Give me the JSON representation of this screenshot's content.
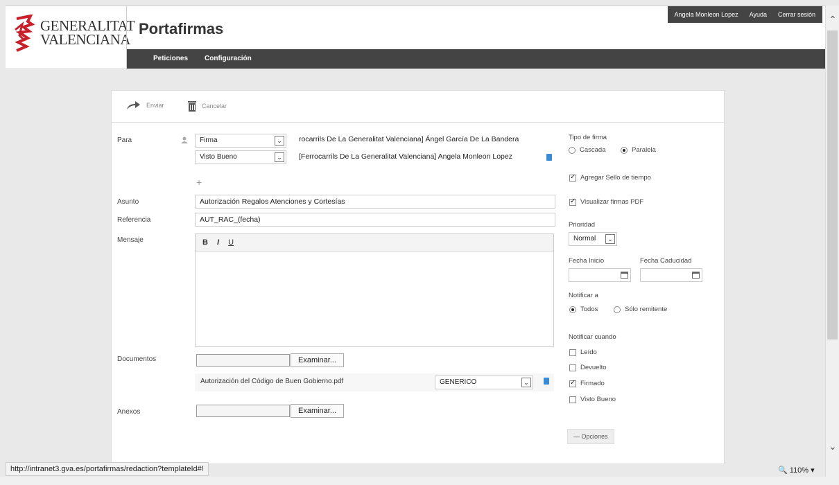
{
  "header": {
    "logo_line1": "GENERALITAT",
    "logo_line2": "VALENCIANA",
    "app_title": "Portafirmas",
    "nav": [
      "Peticiones",
      "Configuración"
    ],
    "user_name": "Angela Monleon Lopez",
    "help": "Ayuda",
    "logout": "Cerrar sesión"
  },
  "toolbar": {
    "send": "Enviar",
    "cancel": "Cancelar"
  },
  "form": {
    "para_label": "Para",
    "recipients": [
      {
        "type": "Firma",
        "name": "rocarrils De La Generalitat Valenciana] Ángel García De La Bandera"
      },
      {
        "type": "Visto Bueno",
        "name": "[Ferrocarrils De La Generalitat Valenciana] Angela Monleon Lopez"
      }
    ],
    "add": "+",
    "asunto_label": "Asunto",
    "asunto_value": "Autorización Regalos Atenciones y Cortesías",
    "referencia_label": "Referencia",
    "referencia_value": "AUT_RAC_(fecha)",
    "mensaje_label": "Mensaje",
    "editor_bold": "B",
    "editor_italic": "I",
    "editor_underline": "U",
    "documentos_label": "Documentos",
    "examinar": "Examinar...",
    "doc_name": "Autorización del Código de Buen Gobierno.pdf",
    "doc_type": "GENERICO",
    "anexos_label": "Anexos"
  },
  "side": {
    "tipo_firma_label": "Tipo de firma",
    "cascada": "Cascada",
    "paralela": "Paralela",
    "sello": "Agregar Sello de tiempo",
    "visualizar": "Visualizar firmas PDF",
    "prioridad_label": "Prioridad",
    "prioridad_value": "Normal",
    "fecha_inicio": "Fecha Inicio",
    "fecha_caducidad": "Fecha Caducidad",
    "notificar_label": "Notificar a",
    "todos": "Todos",
    "solo": "Sólo remitente",
    "notificar_cuando": "Notificar cuando",
    "leido": "Leído",
    "devuelto": "Devuelto",
    "firmado": "Firmado",
    "visto_bueno": "Visto Bueno",
    "opciones": "Opciones"
  },
  "status": {
    "url": "http://intranet3.gva.es/portafirmas/redaction?templateId#!",
    "zoom": "110%"
  }
}
